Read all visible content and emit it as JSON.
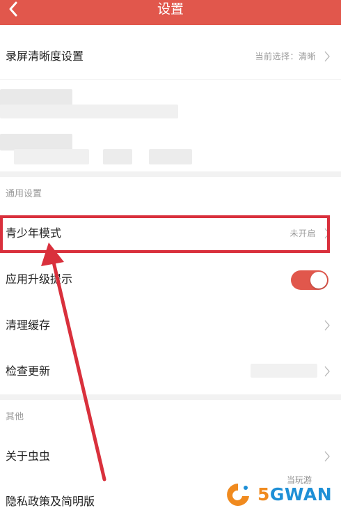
{
  "header": {
    "title": "设置",
    "back_icon": "chevron-left-icon"
  },
  "rows_top": {
    "recording_quality": {
      "label": "录屏清晰度设置",
      "value": "当前选择：清晰"
    }
  },
  "sections": {
    "general": {
      "title": "通用设置"
    },
    "other": {
      "title": "其他"
    }
  },
  "general_items": {
    "youth_mode": {
      "label": "青少年模式",
      "value": "未开启"
    },
    "upgrade_prompt": {
      "label": "应用升级提示",
      "toggle_on": true
    },
    "clear_cache": {
      "label": "清理缓存"
    },
    "check_update": {
      "label": "检查更新"
    }
  },
  "other_items": {
    "about": {
      "label": "关于虫虫"
    },
    "privacy": {
      "label": "隐私政策及简明版"
    }
  },
  "colors": {
    "header_bg": "#e1574c",
    "toggle_on": "#e1574c",
    "annotation_red": "#d9303c"
  },
  "watermark": {
    "text_5": "5",
    "text_rest": "GWAN",
    "small": "当玩游"
  }
}
